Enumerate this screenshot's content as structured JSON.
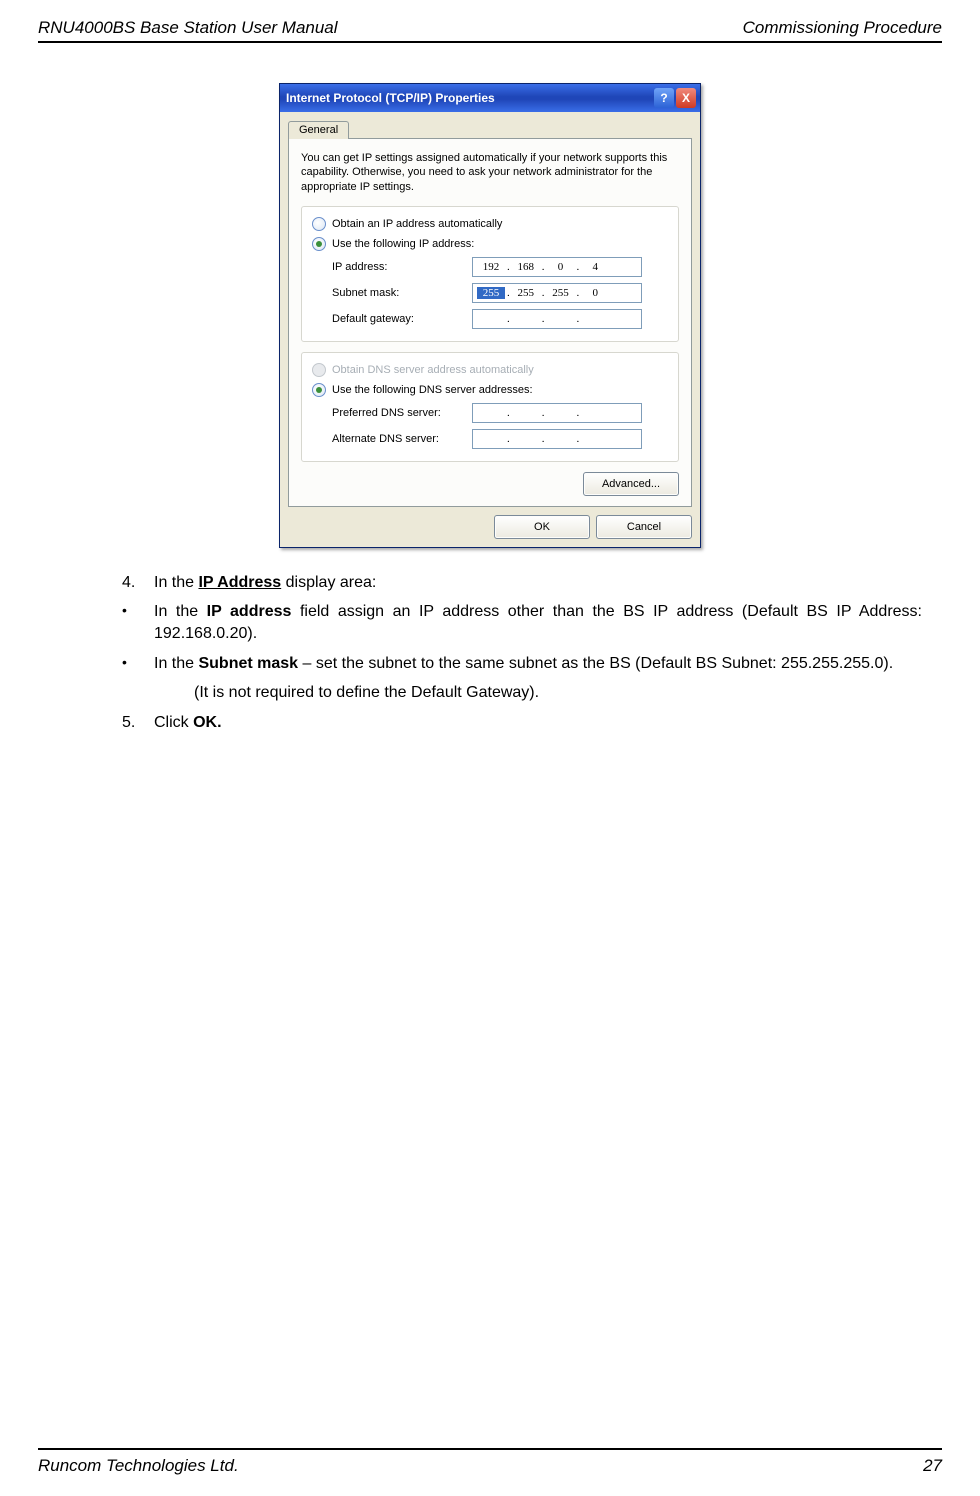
{
  "header": {
    "left": "RNU4000BS Base Station User Manual",
    "right": "Commissioning Procedure"
  },
  "footer": {
    "left": "Runcom Technologies Ltd.",
    "right": "27"
  },
  "dialog": {
    "title": "Internet Protocol (TCP/IP) Properties",
    "help_label": "?",
    "close_label": "X",
    "tab_general": "General",
    "intro": "You can get IP settings assigned automatically if your network supports this capability. Otherwise, you need to ask your network administrator for the appropriate IP settings.",
    "radio_auto_ip": "Obtain an IP address automatically",
    "radio_use_ip": "Use the following IP address:",
    "lbl_ip": "IP address:",
    "lbl_subnet": "Subnet mask:",
    "lbl_gateway": "Default gateway:",
    "ip": {
      "o1": "192",
      "o2": "168",
      "o3": "0",
      "o4": "4"
    },
    "subnet": {
      "o1": "255",
      "o2": "255",
      "o3": "255",
      "o4": "0"
    },
    "gateway": {
      "o1": "",
      "o2": "",
      "o3": "",
      "o4": ""
    },
    "radio_auto_dns": "Obtain DNS server address automatically",
    "radio_use_dns": "Use the following DNS server addresses:",
    "lbl_pdns": "Preferred DNS server:",
    "lbl_adns": "Alternate DNS server:",
    "pdns": {
      "o1": "",
      "o2": "",
      "o3": "",
      "o4": ""
    },
    "adns": {
      "o1": "",
      "o2": "",
      "o3": "",
      "o4": ""
    },
    "btn_advanced": "Advanced...",
    "btn_ok": "OK",
    "btn_cancel": "Cancel"
  },
  "body": {
    "step4_num": "4.",
    "step4_text_a": "In the ",
    "step4_bold": "IP Address",
    "step4_text_b": " display area:",
    "bullet1_a": "In the ",
    "bullet1_bold": "IP address",
    "bullet1_b": " field assign an IP address other than the BS IP address (Default BS IP Address: 192.168.0.20).",
    "bullet2_a": "In the ",
    "bullet2_bold": "Subnet mask",
    "bullet2_b": " – set the subnet to the same subnet as the BS (Default BS Subnet: 255.255.255.0).",
    "note": "(It is not required to define the Default Gateway).",
    "step5_num": "5.",
    "step5_text_a": "Click ",
    "step5_bold": "OK."
  }
}
